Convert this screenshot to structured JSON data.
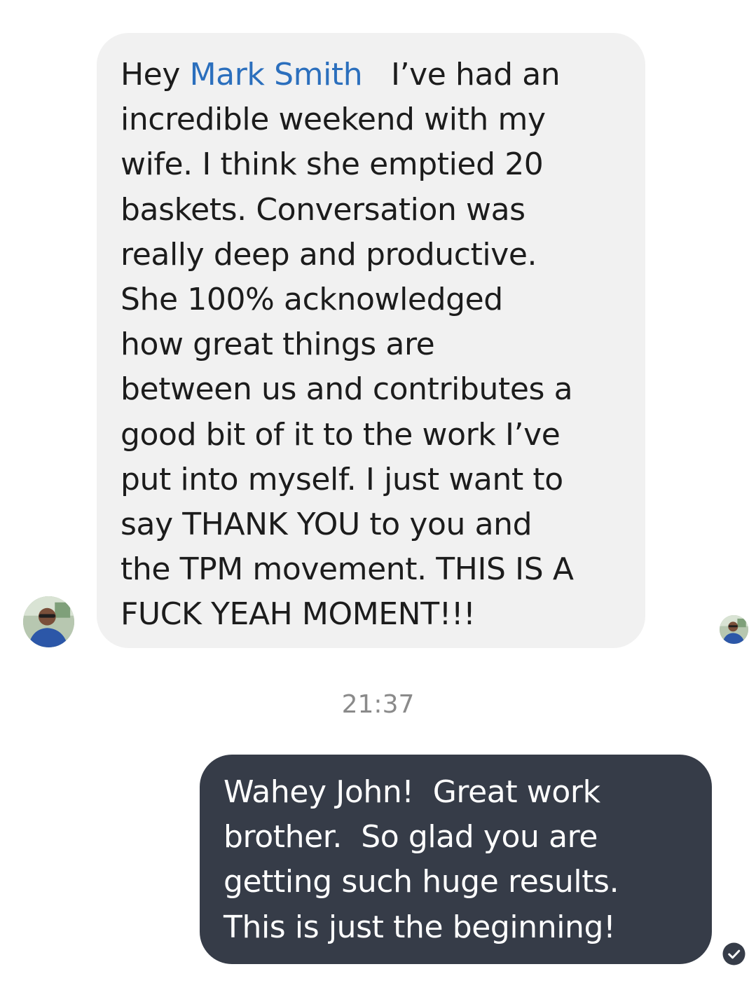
{
  "conversation": {
    "incoming": {
      "greeting": "Hey ",
      "mention": "Mark Smith",
      "lines": [
        "   I’ve had an",
        "incredible weekend with my",
        "wife. I think she emptied 20",
        "baskets. Conversation was",
        "really deep and productive.",
        "She 100% acknowledged",
        "how great things are",
        "between us and contributes a",
        "good bit of it to the work I’ve",
        "put into myself. I just want to",
        "say THANK YOU to you and",
        "the TPM movement. THIS IS A",
        "FUCK YEAH MOMENT!!!"
      ]
    },
    "timestamp": "21:37",
    "outgoing": {
      "lines": [
        "Wahey John!  Great work",
        "brother.  So glad you are",
        "getting such huge results.",
        "This is just the beginning!"
      ]
    }
  },
  "icons": {
    "contact_avatar": "avatar-photo",
    "seen_avatar": "avatar-photo",
    "delivered_status": "check-circle-icon"
  },
  "colors": {
    "incoming_bubble": "#f1f1f1",
    "outgoing_bubble": "#363c48",
    "mention": "#2b6fbd",
    "timestamp": "#8a8a8a"
  }
}
